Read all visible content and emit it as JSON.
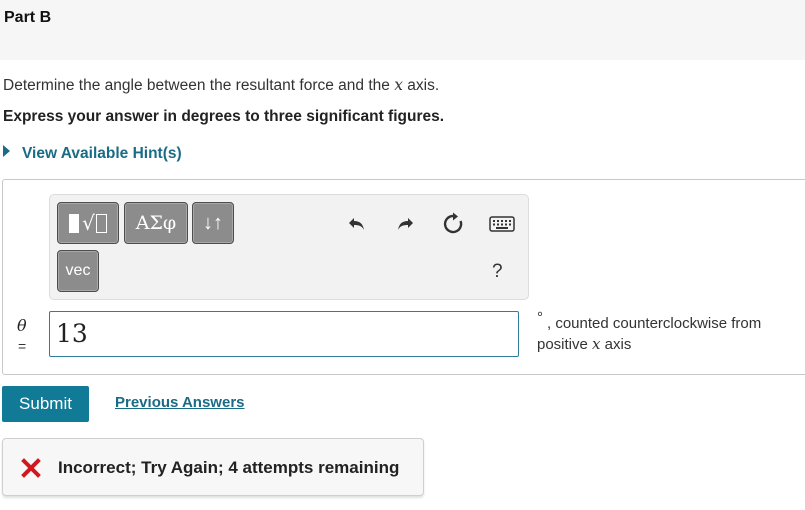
{
  "part": {
    "title": "Part B"
  },
  "question": {
    "text_before": "Determine the angle between the resultant force and the ",
    "variable": "x",
    "text_after": " axis."
  },
  "instruction": "Express your answer in degrees to three significant figures.",
  "hint": {
    "label": "View Available Hint(s)"
  },
  "toolbar": {
    "greek_label": "ΑΣφ",
    "arrows_label": "↓↑",
    "vec_label": "vec",
    "help_label": "?",
    "icons": [
      "templates-icon",
      "undo-icon",
      "redo-icon",
      "reset-icon",
      "keyboard-icon",
      "help-icon"
    ]
  },
  "answer": {
    "variable": "θ",
    "equals": "=",
    "value": "13",
    "unit_degree": "°",
    "unit_text_before": ", counted counterclockwise from positive ",
    "unit_variable": "x",
    "unit_text_after": " axis"
  },
  "actions": {
    "submit_label": "Submit",
    "previous_answers_label": "Previous Answers"
  },
  "feedback": {
    "message": "Incorrect; Try Again; 4 attempts remaining",
    "status_color": "#d0181f"
  },
  "colors": {
    "accent": "#117a96",
    "link": "#1a6b86",
    "input_border": "#2f7c9b"
  }
}
